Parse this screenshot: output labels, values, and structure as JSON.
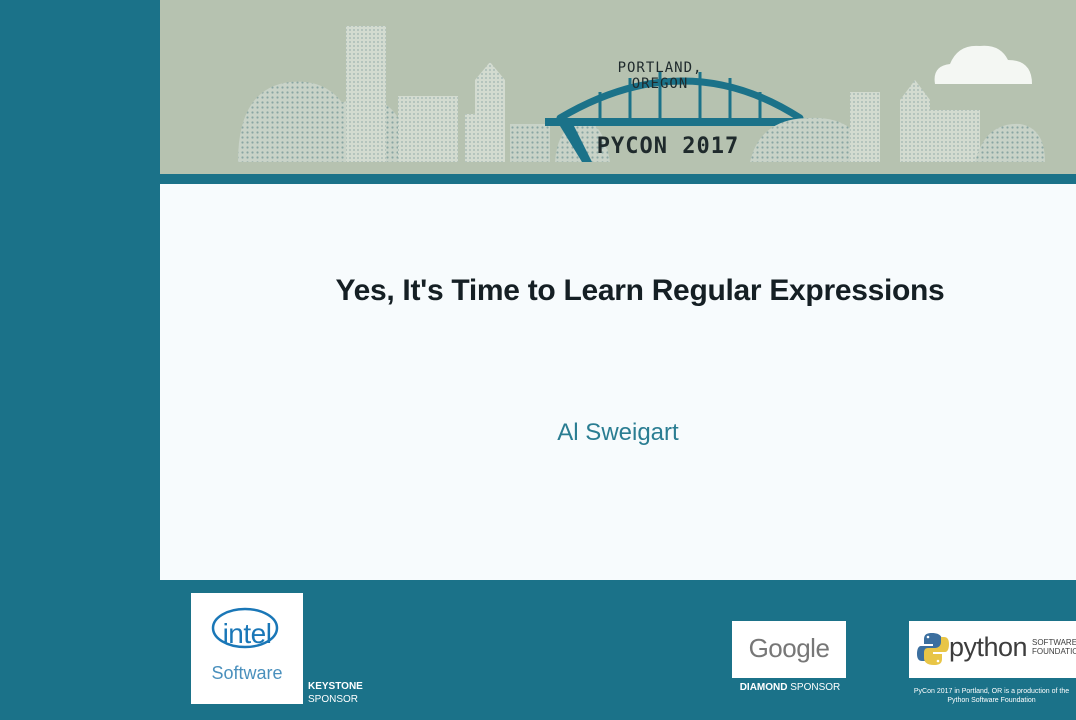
{
  "banner": {
    "city_text": "PORTLAND, OREGON",
    "conference_text": "PYCON 2017"
  },
  "slide": {
    "title": "Yes, It's Time to Learn Regular Expressions",
    "speaker": "Al Sweigart"
  },
  "sponsors": {
    "keystone": {
      "logo_word": "intel",
      "logo_sub": "Software",
      "tier_bold": "KEYSTONE",
      "tier_rest": "SPONSOR"
    },
    "diamond": {
      "logo_word": "Google",
      "tier_bold": "DIAMOND",
      "tier_rest": "SPONSOR"
    },
    "organizer": {
      "logo_word": "python",
      "logo_small_1": "SOFTWARE",
      "logo_small_2": "FOUNDATION",
      "note_line1": "PyCon 2017 in Portland, OR is a production of the",
      "note_line2": "Python Software Foundation"
    }
  },
  "colors": {
    "teal": "#1b7289",
    "banner_bg": "#b6c2b0",
    "slide_bg": "#f7fbfd",
    "speaker": "#2a7d92"
  }
}
